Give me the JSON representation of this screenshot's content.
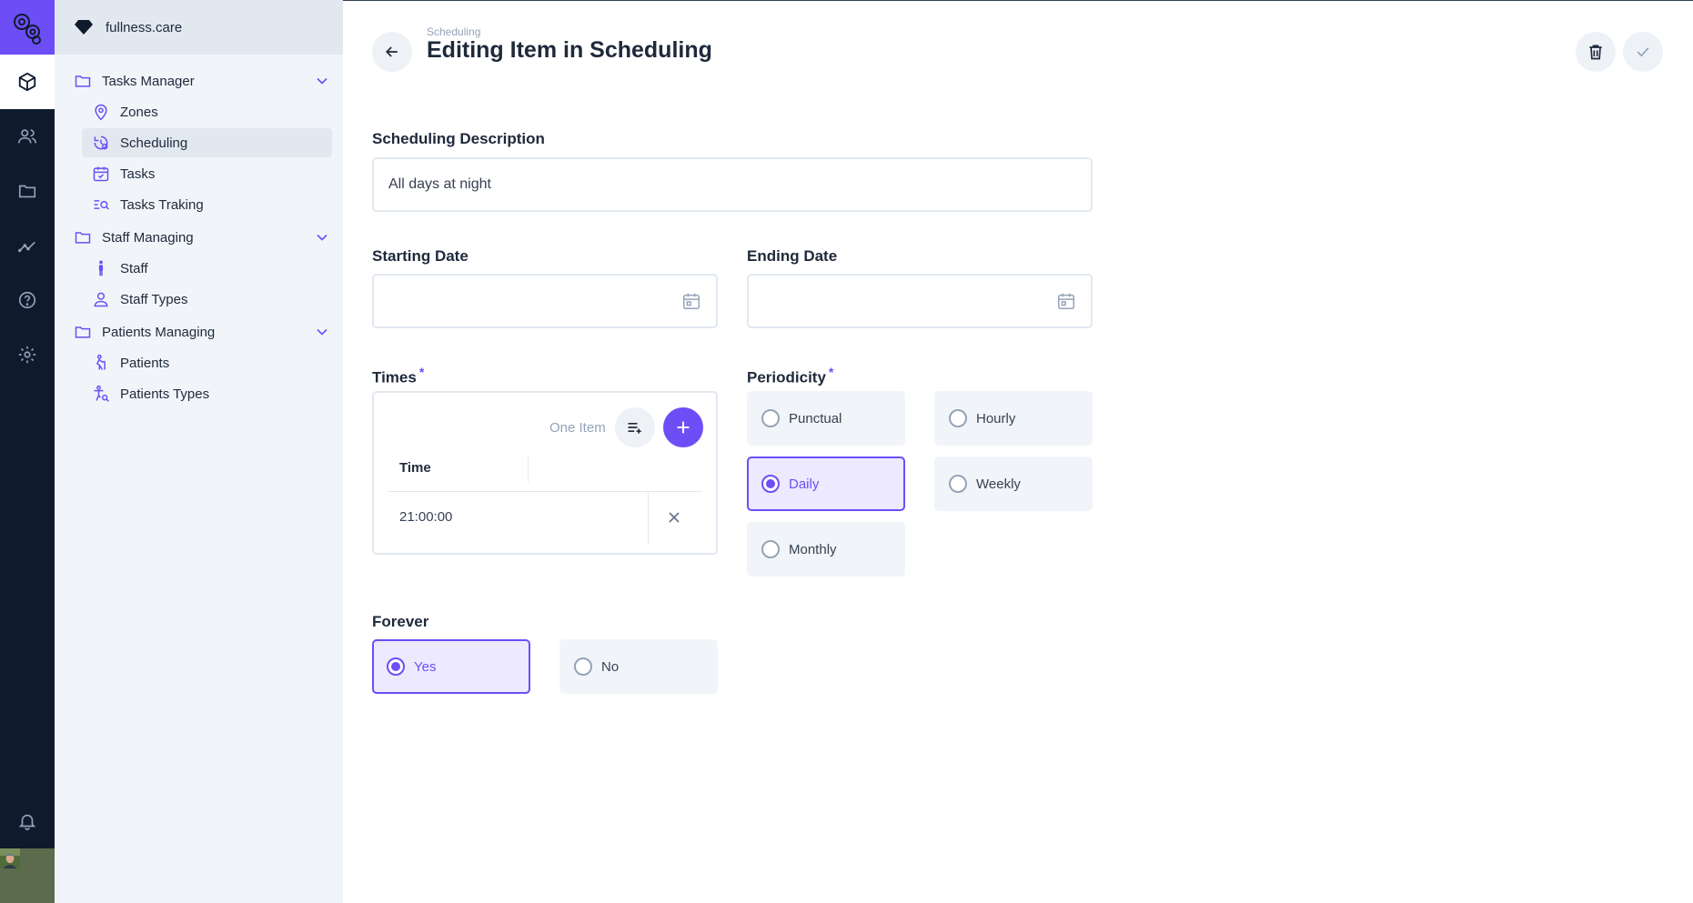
{
  "org": {
    "name": "fullness.care"
  },
  "sidebar": {
    "groups": [
      {
        "label": "Tasks Manager",
        "items": [
          "Zones",
          "Scheduling",
          "Tasks",
          "Tasks Traking"
        ]
      },
      {
        "label": "Staff Managing",
        "items": [
          "Staff",
          "Staff Types"
        ]
      },
      {
        "label": "Patients Managing",
        "items": [
          "Patients",
          "Patients Types"
        ]
      }
    ],
    "active_item": "Scheduling"
  },
  "header": {
    "breadcrumb": "Scheduling",
    "title": "Editing Item in Scheduling"
  },
  "form": {
    "description": {
      "label": "Scheduling Description",
      "value": "All days at night"
    },
    "starting_date": {
      "label": "Starting Date",
      "value": ""
    },
    "ending_date": {
      "label": "Ending Date",
      "value": ""
    },
    "times": {
      "label": "Times",
      "required_mark": "*",
      "count": "One Item",
      "column": "Time",
      "rows": [
        "21:00:00"
      ]
    },
    "periodicity": {
      "label": "Periodicity",
      "required_mark": "*",
      "options": [
        "Punctual",
        "Hourly",
        "Daily",
        "Weekly",
        "Monthly"
      ],
      "selected": "Daily"
    },
    "forever": {
      "label": "Forever",
      "options": [
        "Yes",
        "No"
      ],
      "selected": "Yes"
    }
  },
  "colors": {
    "accent": "#6d4ef6",
    "rail": "#0f1b2d",
    "sidebar": "#f1f5f9"
  },
  "icons": [
    "cube-icon",
    "users-icon",
    "folder-icon",
    "chart-line-icon",
    "help-circle-icon",
    "gear-icon",
    "bell-icon"
  ]
}
